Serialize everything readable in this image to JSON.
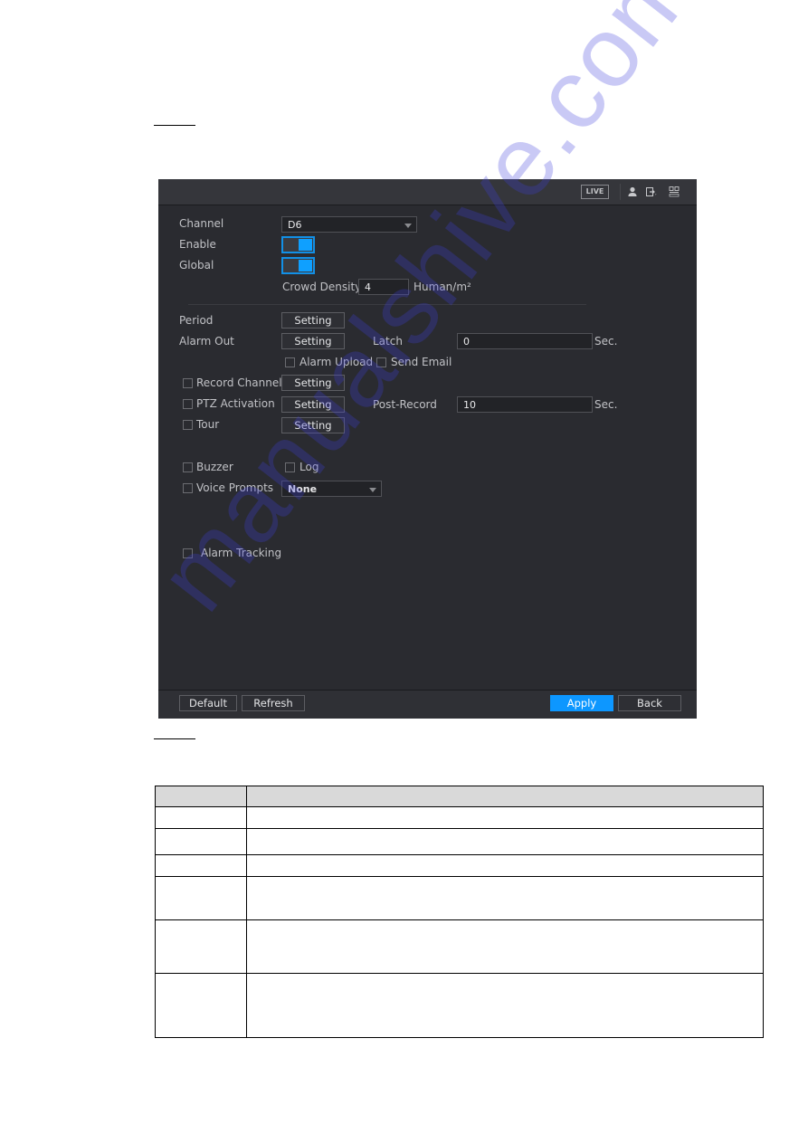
{
  "document": {
    "table": {
      "headers": [
        "",
        ""
      ],
      "rows": [
        [
          "",
          ""
        ],
        [
          "",
          ""
        ],
        [
          "",
          ""
        ],
        [
          "",
          ""
        ],
        [
          "",
          ""
        ],
        [
          "",
          ""
        ]
      ]
    }
  },
  "ui": {
    "topbar": {
      "live_label": "LIVE",
      "icons": [
        "user-icon",
        "logout-icon",
        "qr-code-icon"
      ]
    },
    "form": {
      "channel": {
        "label": "Channel",
        "value": "D6"
      },
      "enable": {
        "label": "Enable",
        "on": true
      },
      "global": {
        "label": "Global",
        "on": true
      },
      "crowd_density": {
        "label": "Crowd Density",
        "value": "4",
        "unit": "Human/m²"
      },
      "period": {
        "label": "Period",
        "button": "Setting"
      },
      "alarm_out": {
        "label": "Alarm Out",
        "button": "Setting"
      },
      "latch": {
        "label": "Latch",
        "value": "0",
        "unit": "Sec."
      },
      "alarm_upload": {
        "label": "Alarm Upload",
        "checked": false
      },
      "send_email": {
        "label": "Send Email",
        "checked": false
      },
      "record_channel": {
        "label": "Record Channel",
        "button": "Setting",
        "checked": false
      },
      "ptz_activation": {
        "label": "PTZ Activation",
        "button": "Setting",
        "checked": false
      },
      "post_record": {
        "label": "Post-Record",
        "value": "10",
        "unit": "Sec."
      },
      "tour": {
        "label": "Tour",
        "button": "Setting",
        "checked": false
      },
      "buzzer": {
        "label": "Buzzer",
        "checked": false
      },
      "log": {
        "label": "Log",
        "checked": false
      },
      "voice_prompts": {
        "label": "Voice Prompts",
        "value": "None",
        "checked": false
      },
      "alarm_tracking": {
        "label": "Alarm Tracking",
        "checked": false
      }
    },
    "footer": {
      "default_label": "Default",
      "refresh_label": "Refresh",
      "apply_label": "Apply",
      "back_label": "Back"
    },
    "colors": {
      "accent": "#0d97ff",
      "background": "#2a2b30"
    }
  },
  "watermark": "manualshive.com"
}
